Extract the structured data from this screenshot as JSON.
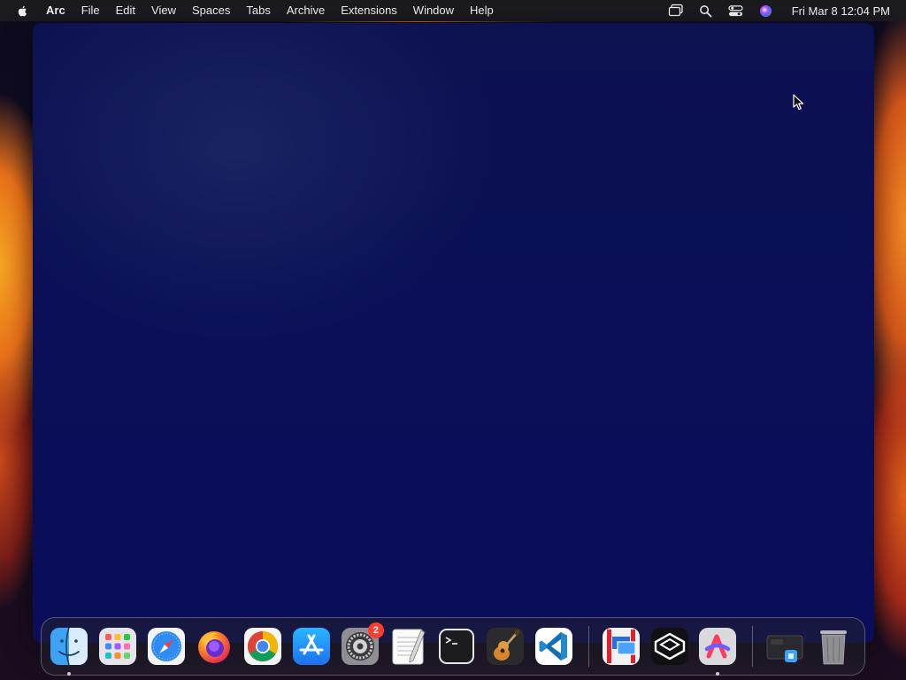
{
  "menubar": {
    "app_name": "Arc",
    "items": [
      "File",
      "Edit",
      "View",
      "Spaces",
      "Tabs",
      "Archive",
      "Extensions",
      "Window",
      "Help"
    ],
    "clock": "Fri Mar 8  12:04 PM",
    "status_icons": [
      "screen-mirroring-icon",
      "spotlight-search-icon",
      "control-center-icon",
      "siri-icon"
    ]
  },
  "dock": {
    "apps": [
      {
        "name": "Finder",
        "icon": "finder-icon",
        "running": true
      },
      {
        "name": "Launchpad",
        "icon": "launchpad-icon",
        "running": false
      },
      {
        "name": "Safari",
        "icon": "safari-icon",
        "running": false
      },
      {
        "name": "Firefox",
        "icon": "firefox-icon",
        "running": false
      },
      {
        "name": "Google Chrome",
        "icon": "chrome-icon",
        "running": false
      },
      {
        "name": "App Store",
        "icon": "app-store-icon",
        "running": false
      },
      {
        "name": "System Settings",
        "icon": "system-settings-icon",
        "running": false,
        "badge": "2"
      },
      {
        "name": "TextEdit",
        "icon": "textedit-icon",
        "running": false
      },
      {
        "name": "Terminal",
        "icon": "terminal-icon",
        "running": false
      },
      {
        "name": "GarageBand",
        "icon": "garageband-icon",
        "running": false
      },
      {
        "name": "Visual Studio Code",
        "icon": "vscode-icon",
        "running": false
      },
      {
        "name": "Parallels",
        "icon": "parallels-icon",
        "running": false
      },
      {
        "name": "Cursor",
        "icon": "cursor-app-icon",
        "running": false
      },
      {
        "name": "Arc",
        "icon": "arc-icon",
        "running": true
      },
      {
        "name": "Downloads Stack",
        "icon": "downloads-stack-icon",
        "running": false
      },
      {
        "name": "Trash",
        "icon": "trash-icon",
        "running": false
      }
    ]
  },
  "colors": {
    "window_bg": "#0a0f57",
    "menubar_bg": "#1c1c20",
    "badge": "#ff3b30"
  }
}
